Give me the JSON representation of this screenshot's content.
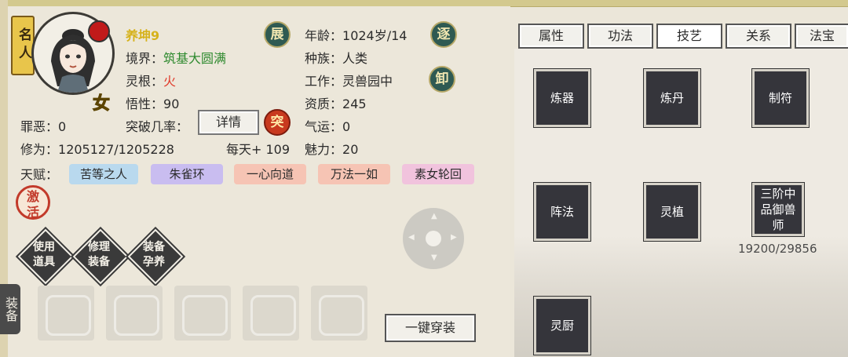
{
  "character": {
    "fame_badge": "名人",
    "name": "养坤9",
    "gender": "女",
    "realm_label": "境界：",
    "realm": "筑基大圆满",
    "root_label": "灵根：",
    "root": "火",
    "comprehension_label": "悟性：",
    "comprehension": "90",
    "breakthrough_label": "突破几率：",
    "detail_button": "详情",
    "sin_label": "罪恶：",
    "sin": "0",
    "cultivation_label": "修为：",
    "cultivation": "1205127/1205228",
    "daily_gain": "每天+ 109",
    "age_label": "年龄：",
    "age": "1024岁/14",
    "race_label": "种族：",
    "race": "人类",
    "job_label": "工作：",
    "job": "灵兽园中",
    "aptitude_label": "资质：",
    "aptitude": "245",
    "luck_label": "气运：",
    "luck": "0",
    "charm_label": "魅力：",
    "charm": "20",
    "round_buttons": {
      "expand": "展",
      "chase": "逐",
      "unload": "卸",
      "breakthrough": "突"
    }
  },
  "talents": {
    "label": "天赋：",
    "items": [
      {
        "text": "苦等之人",
        "color": "#b9d9ee"
      },
      {
        "text": "朱雀环",
        "color": "#c9bdf0"
      },
      {
        "text": "一心向道",
        "color": "#f6c4b4"
      },
      {
        "text": "万法一如",
        "color": "#f6c4b4"
      },
      {
        "text": "素女轮回",
        "color": "#f1c3dd"
      }
    ]
  },
  "actions": {
    "awaken": "激活",
    "use_item": "使用道具",
    "repair": "修理装备",
    "nurture": "装备孕养",
    "equip_all": "一键穿装",
    "equip_tab": "装备"
  },
  "tabs": [
    "属性",
    "功法",
    "技艺",
    "关系",
    "法宝"
  ],
  "active_tab": "技艺",
  "skills": [
    {
      "label": "炼器"
    },
    {
      "label": "炼丹"
    },
    {
      "label": "制符"
    },
    {
      "label": "阵法"
    },
    {
      "label": "灵植"
    },
    {
      "label": "三阶中品御兽师",
      "progress": "19200/29856"
    },
    {
      "label": "灵厨"
    }
  ],
  "equipment_slots": [
    "armor-slot-icon",
    "sword-slot-icon",
    "bracelet-slot-icon",
    "boots-slot-icon",
    "crossbow-slot-icon"
  ]
}
